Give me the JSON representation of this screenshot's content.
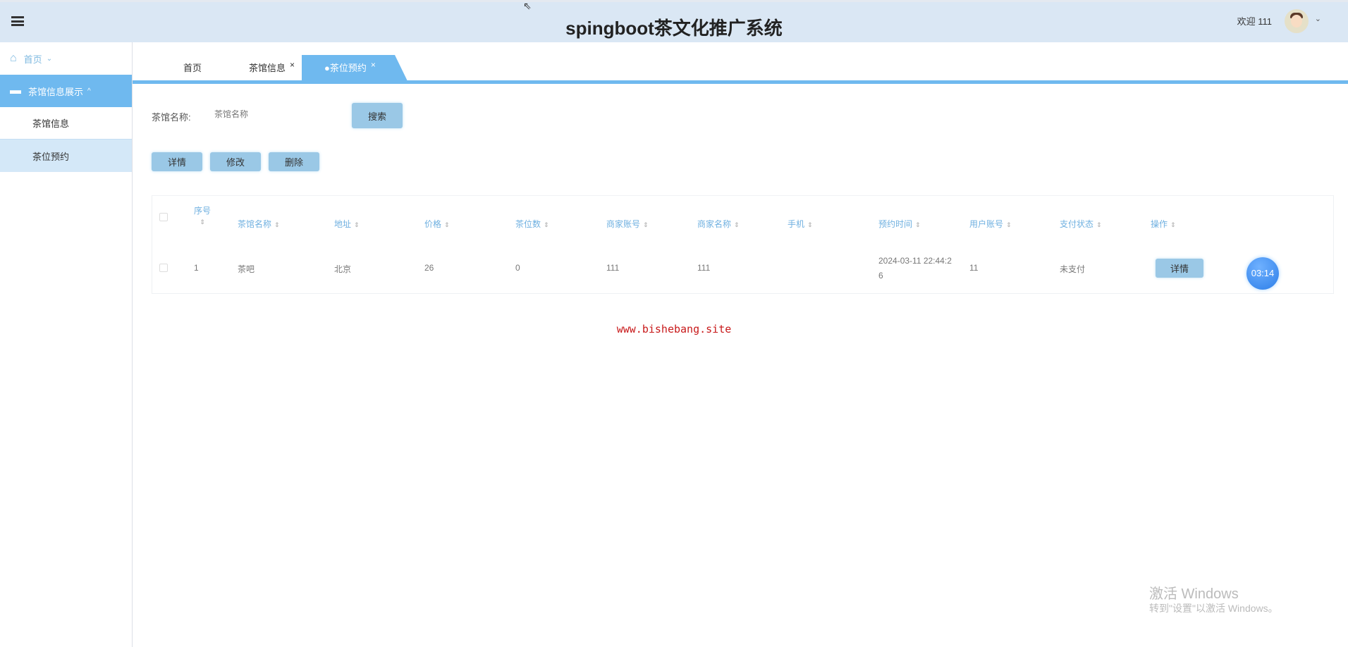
{
  "header": {
    "title": "spingboot茶文化推广系统",
    "welcome": "欢迎 111",
    "user_chevron": "⌄"
  },
  "sidebar": {
    "home": "首页",
    "group": "茶馆信息展示",
    "items": [
      "茶馆信息",
      "茶位预约"
    ]
  },
  "tabs": [
    {
      "label": "首页"
    },
    {
      "label": "茶馆信息",
      "close": "×"
    },
    {
      "label": "●茶位预约",
      "close": "×"
    }
  ],
  "search": {
    "label": "茶馆名称:",
    "placeholder": "茶馆名称",
    "button": "搜索"
  },
  "actions": {
    "detail": "详情",
    "edit": "修改",
    "delete": "删除"
  },
  "table": {
    "headers": [
      "序号",
      "茶馆名称",
      "地址",
      "价格",
      "茶位数",
      "商家账号",
      "商家名称",
      "手机",
      "预约时间",
      "用户账号",
      "支付状态",
      "操作"
    ],
    "rows": [
      {
        "index": "1",
        "name": "茶吧",
        "address": "北京",
        "price": "26",
        "seats": "0",
        "merchant_account": "111",
        "merchant_name": "111",
        "phone": "",
        "time": "2024-03-11 22:44:26",
        "user_account": "11",
        "pay_status": "未支付",
        "action": "详情"
      }
    ]
  },
  "timer": "03:14",
  "watermark": "www.bishebang.site",
  "os_notice": {
    "title": "激活 Windows",
    "subtitle": "转到\"设置\"以激活 Windows。"
  },
  "colors": {
    "accent": "#6fb9ef",
    "header_bg": "#dae7f4",
    "button": "#9ac8e6"
  }
}
